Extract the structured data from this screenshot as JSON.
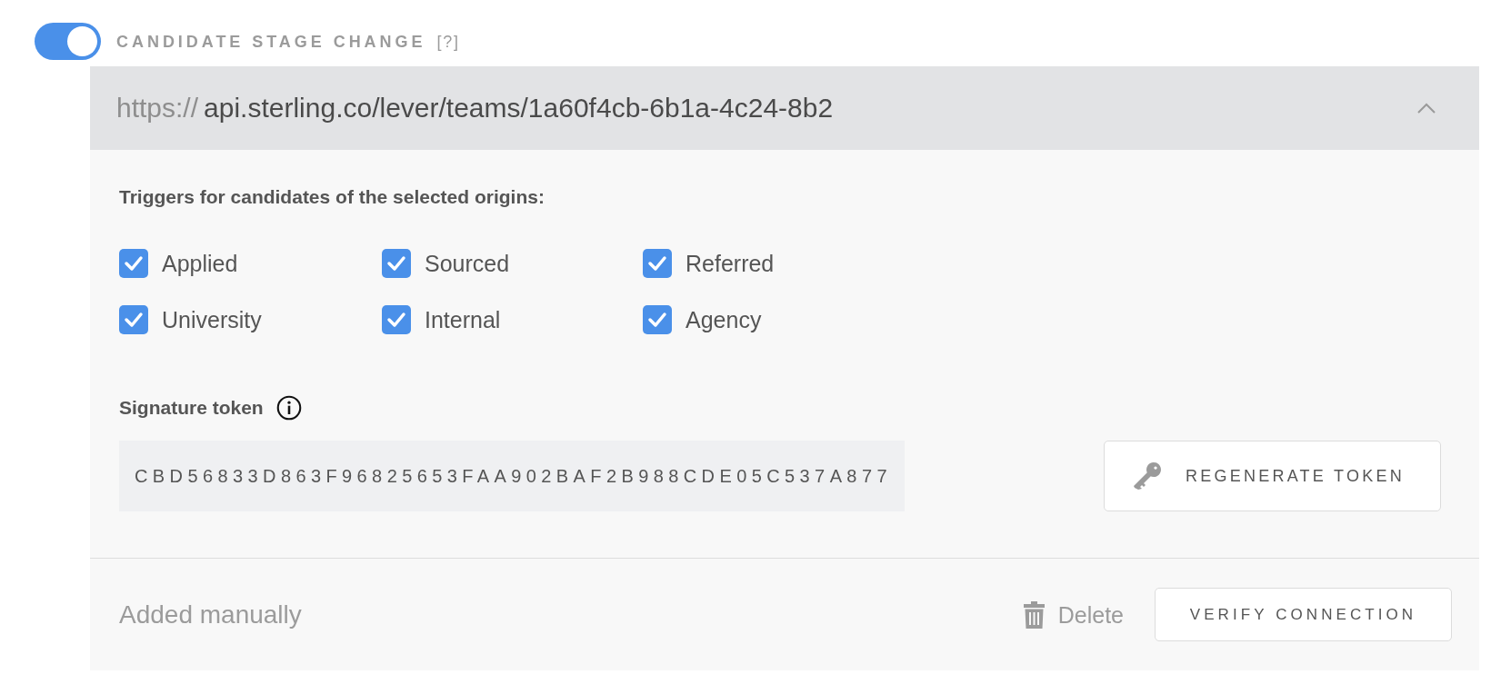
{
  "toggle": {
    "on": true
  },
  "section": {
    "title": "CANDIDATE STAGE CHANGE",
    "help": "[?]"
  },
  "header": {
    "url_scheme": "https://",
    "url": "api.sterling.co/lever/teams/1a60f4cb-6b1a-4c24-8b2",
    "expanded": true
  },
  "origins": {
    "heading": "Triggers for candidates of the selected origins:",
    "items": [
      {
        "label": "Applied",
        "checked": true
      },
      {
        "label": "Sourced",
        "checked": true
      },
      {
        "label": "Referred",
        "checked": true
      },
      {
        "label": "University",
        "checked": true
      },
      {
        "label": "Internal",
        "checked": true
      },
      {
        "label": "Agency",
        "checked": true
      }
    ]
  },
  "signature_token": {
    "label": "Signature token",
    "value": "CBD56833D863F96825653FAA902BAF2B988CDE05C537A877",
    "regenerate_button": "REGENERATE TOKEN"
  },
  "footer": {
    "source": "Added manually",
    "delete_button": "Delete",
    "verify_button": "VERIFY CONNECTION"
  }
}
